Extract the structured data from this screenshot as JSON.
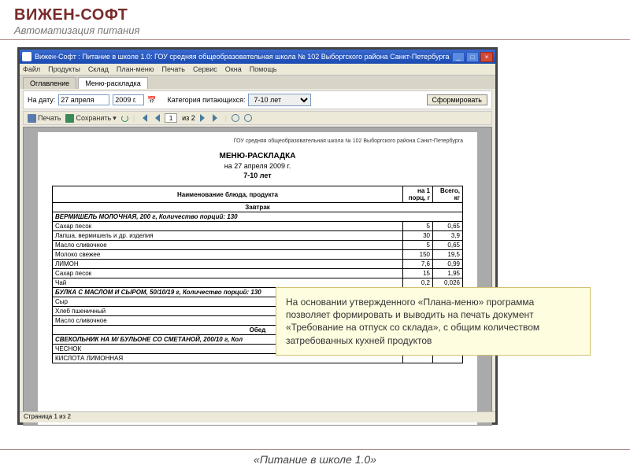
{
  "slide": {
    "brand": "ВИЖЕН-СОФТ",
    "subtitle": "Автоматизация питания",
    "footer": "«Питание в школе 1.0»"
  },
  "window": {
    "title": "Вижен-Софт : Питание в школе 1.0: ГОУ средняя общеобразовательная школа № 102 Выборгского района Санкт-Петербурга",
    "min": "_",
    "max": "□",
    "close": "×"
  },
  "menubar": {
    "file": "Файл",
    "products": "Продукты",
    "warehouse": "Склад",
    "plan": "План-меню",
    "print": "Печать",
    "service": "Сервис",
    "window_m": "Окна",
    "help": "Помощь"
  },
  "tabs": {
    "toc": "Оглавление",
    "layout": "Меню-раскладка"
  },
  "filter": {
    "on_date": "На дату:",
    "date": "27 апреля",
    "year": "2009 г.",
    "cal_tip": "📅",
    "category_lbl": "Категория питающихся:",
    "category": "7-10 лет",
    "generate": "Сформировать"
  },
  "toolbar": {
    "print": "Печать",
    "save": "Сохранить",
    "page": "1",
    "of": "из 2"
  },
  "document": {
    "org": "ГОУ средняя общеобразовательная школа № 102 Выборгского района Санкт-Петербурга",
    "title": "МЕНЮ-РАСКЛАДКА",
    "date": "на 27 апреля 2009 г.",
    "age": "7-10 лет",
    "h_name": "Наименование блюда, продукта",
    "h_per": "на 1 порц, г",
    "h_total": "Всего, кг",
    "meals": {
      "breakfast": "Завтрак",
      "lunch": "Обед"
    },
    "dishes": {
      "d1": "ВЕРМИШЕЛЬ МОЛОЧНАЯ, 200 г, Количество порций: 130",
      "d2": "БУЛКА С МАСЛОМ И СЫРОМ, 50/10/19 г, Количество порций: 130",
      "d3": "СВЕКОЛЬНИК НА М/ БУЛЬОНЕ СО СМЕТАНОЙ, 200/10 г, Кол"
    },
    "rows": {
      "r0": {
        "n": "Сахар песок",
        "p": "5",
        "t": "0,65"
      },
      "r1": {
        "n": "Лапша, вермишель и др. изделия",
        "p": "30",
        "t": "3,9"
      },
      "r2": {
        "n": "Масло сливочное",
        "p": "5",
        "t": "0,65"
      },
      "r3": {
        "n": "Молоко свежее",
        "p": "150",
        "t": "19,5"
      },
      "r4": {
        "n": "ЛИМОН",
        "p": "7,6",
        "t": "0,99"
      },
      "r5": {
        "n": "Сахар песок",
        "p": "15",
        "t": "1,95"
      },
      "r6": {
        "n": "Чай",
        "p": "0,2",
        "t": "0,026"
      },
      "r7": {
        "n": "Сыр",
        "p": "",
        "t": ""
      },
      "r8": {
        "n": "Хлеб пшеничный",
        "p": "",
        "t": ""
      },
      "r9": {
        "n": "Масло сливочное",
        "p": "",
        "t": ""
      },
      "r10": {
        "n": "ЧЕСНОК",
        "p": "",
        "t": ""
      },
      "r11": {
        "n": "КИСЛОТА ЛИМОННАЯ",
        "p": "",
        "t": ""
      }
    }
  },
  "status": {
    "page": "Страница 1 из 2"
  },
  "callout": {
    "text": "На основании утвержденного «Плана-меню» программа позволяет формировать и выводить на печать документ «Требование на отпуск со склада», с общим количеством затребованных кухней продуктов"
  }
}
